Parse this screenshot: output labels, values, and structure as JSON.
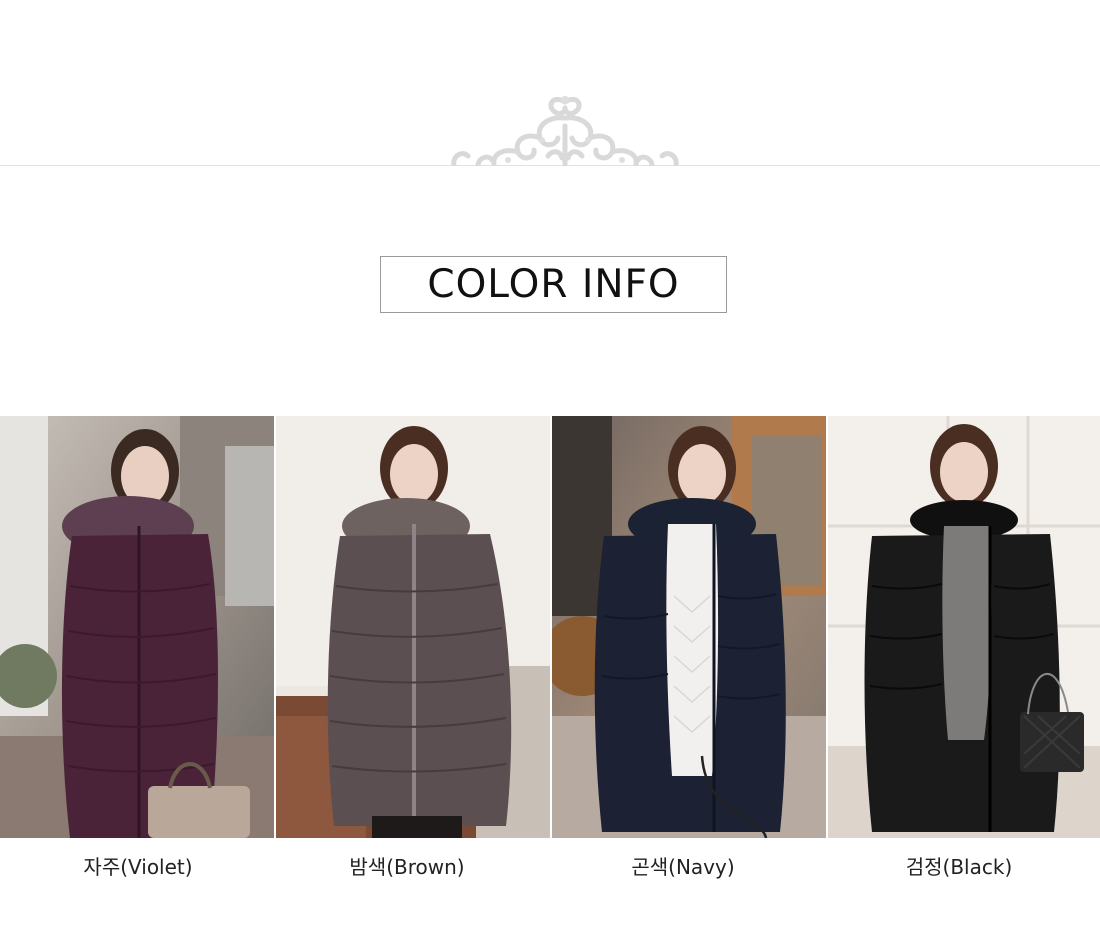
{
  "section": {
    "title": "COLOR INFO"
  },
  "colors": [
    {
      "label": "자주(Violet)",
      "swatch": "#4a2338"
    },
    {
      "label": "밤색(Brown)",
      "swatch": "#5c4f52"
    },
    {
      "label": "곤색(Navy)",
      "swatch": "#1c2233"
    },
    {
      "label": "검정(Black)",
      "swatch": "#1a1a1a"
    }
  ],
  "icons": {
    "ornament": "filigree-ornament-icon"
  }
}
